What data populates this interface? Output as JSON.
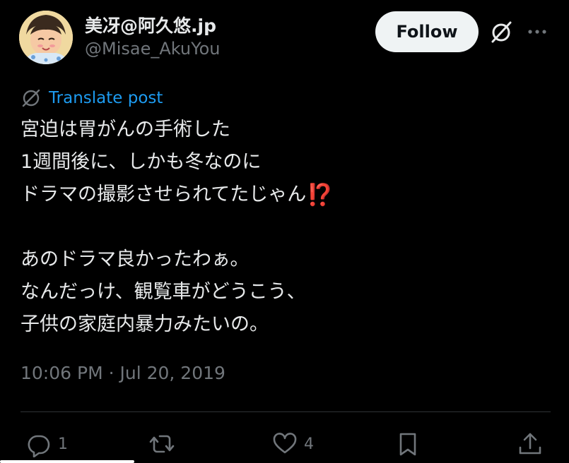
{
  "author": {
    "display_name": "美冴@阿久悠.jp",
    "handle": "@Misae_AkuYou",
    "avatar_icon": "avatar-illustration-icon"
  },
  "header": {
    "follow_label": "Follow",
    "grok_icon": "grok-slash-circle-icon",
    "more_icon": "more-dots-icon"
  },
  "translate": {
    "label": "Translate post",
    "icon": "translate-globe-icon",
    "color": "#1d9bf0"
  },
  "post": {
    "lines": [
      "宮迫は胃がんの手術した",
      "1週間後に、しかも冬なのに",
      "ドラマの撮影させられてたじゃん",
      "",
      "あのドラマ良かったわぁ。",
      "なんだっけ、観覧車がどうこう、",
      "子供の家庭内暴力みたいの。"
    ],
    "emoji": "⁉️",
    "timestamp": "10:06 PM · Jul 20, 2019"
  },
  "actions": {
    "reply": {
      "icon": "reply-bubble-icon",
      "count": "1"
    },
    "retweet": {
      "icon": "retweet-icon",
      "count": ""
    },
    "like": {
      "icon": "heart-icon",
      "count": "4"
    },
    "bookmark": {
      "icon": "bookmark-icon"
    },
    "share": {
      "icon": "share-upload-icon"
    }
  },
  "colors": {
    "background": "#000000",
    "text": "#e7e9ea",
    "secondary": "#71767b",
    "accent": "#1d9bf0",
    "divider": "#2f3336"
  }
}
